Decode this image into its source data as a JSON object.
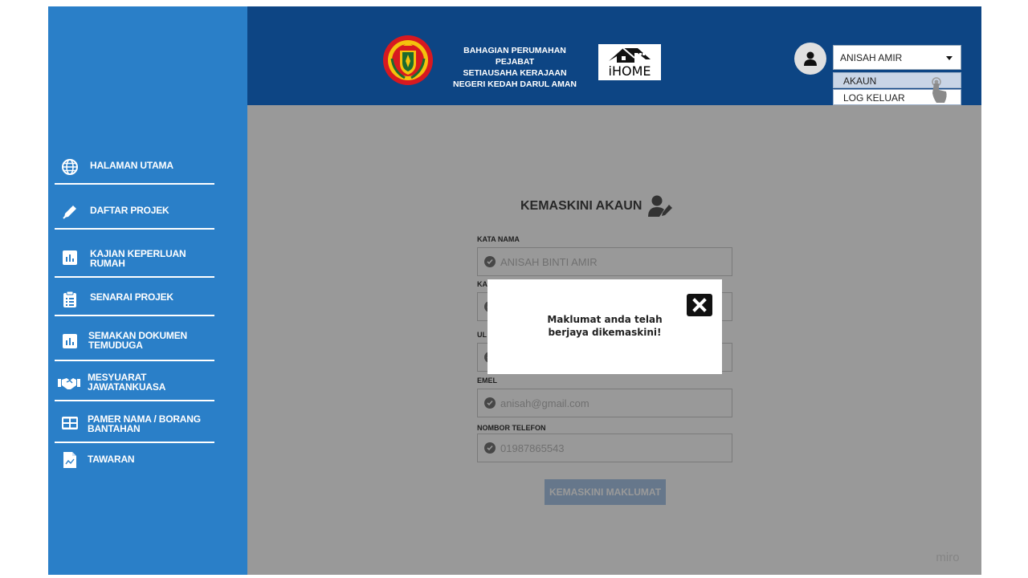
{
  "header": {
    "org_name_line1": "BAHAGIAN PERUMAHAN PEJABAT",
    "org_name_line2": "SETIAUSAHA KERAJAAN",
    "org_name_line3": "NEGERI KEDAH DARUL AMAN",
    "app_logo_text": "iHOME",
    "user_name": "ANISAH AMIR",
    "user_menu": [
      "AKAUN",
      "LOG KELUAR"
    ]
  },
  "sidebar": {
    "items": [
      {
        "label": "HALAMAN UTAMA",
        "icon": "globe-icon"
      },
      {
        "label": "DAFTAR PROJEK",
        "icon": "pen-icon"
      },
      {
        "label": "KAJIAN KEPERLUAN RUMAH",
        "icon": "chart-icon"
      },
      {
        "label": "SENARAI PROJEK",
        "icon": "clipboard-icon"
      },
      {
        "label": "SEMAKAN DOKUMEN TEMUDUGA",
        "icon": "chart-icon"
      },
      {
        "label": "MESYUARAT JAWATANKUASA",
        "icon": "handshake-icon"
      },
      {
        "label": "PAMER NAMA / BORANG BANTAHAN",
        "icon": "table-icon"
      },
      {
        "label": "TAWARAN",
        "icon": "document-icon"
      }
    ]
  },
  "form": {
    "title": "KEMASKINI AKAUN",
    "fields": [
      {
        "label": "KATA NAMA",
        "value": "ANISAH BINTI AMIR"
      },
      {
        "label": "KA",
        "value": ""
      },
      {
        "label": "UL",
        "value": ""
      },
      {
        "label": "EMEL",
        "value": "anisah@gmail.com"
      },
      {
        "label": "NOMBOR TELEFON",
        "value": "01987865543"
      }
    ],
    "submit_label": "KEMASKINI MAKLUMAT"
  },
  "modal": {
    "message": "Maklumat anda telah berjaya dikemaskini!"
  },
  "watermark": "miro",
  "colors": {
    "sidebar": "#2a7fc8",
    "header": "#0d4584",
    "button": "#aac7e8"
  }
}
